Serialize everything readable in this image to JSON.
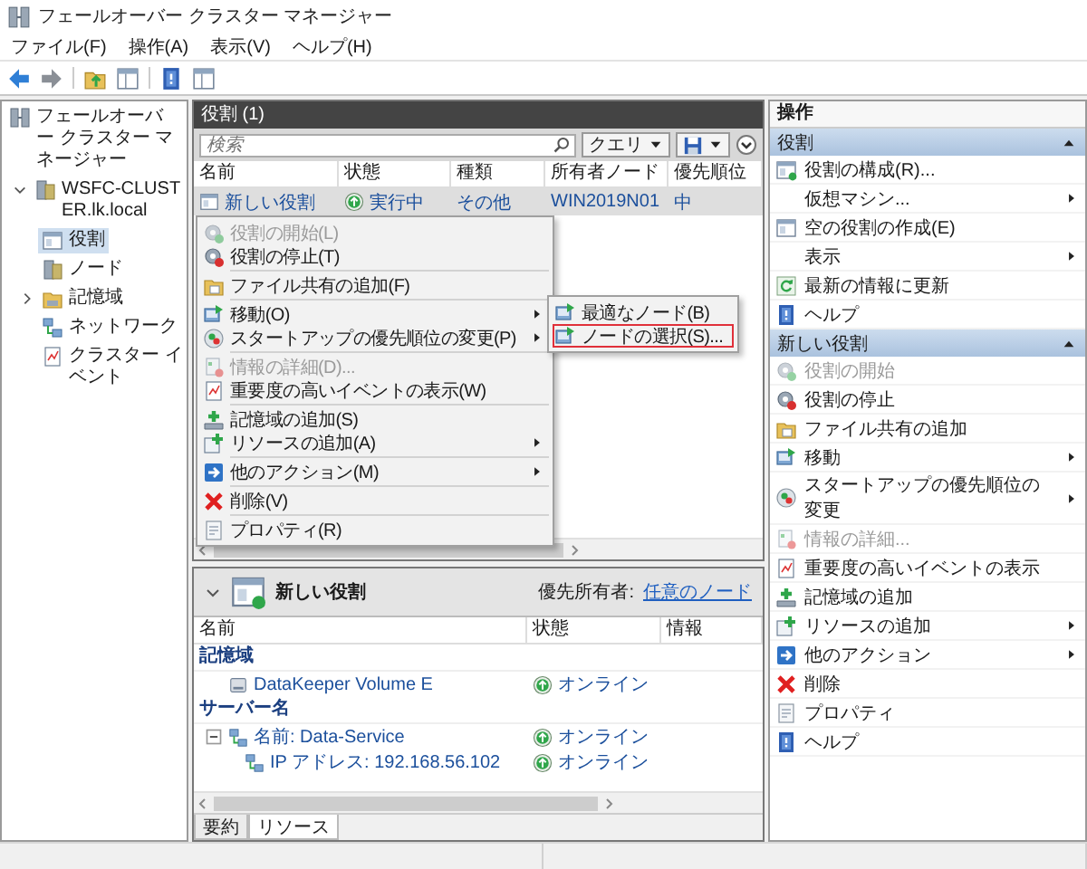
{
  "window": {
    "title": "フェールオーバー クラスター マネージャー"
  },
  "menu_bar": [
    "ファイル(F)",
    "操作(A)",
    "表示(V)",
    "ヘルプ(H)"
  ],
  "tree": {
    "label": "フェールオーバー クラスター マネージャー",
    "selected": false,
    "children": [
      {
        "label": "WSFC-CLUSTER.lk.local",
        "selected": false,
        "expanded": true,
        "children": [
          {
            "label": "役割",
            "selected": true
          },
          {
            "label": "ノード",
            "selected": false
          },
          {
            "label": "記憶域",
            "selected": false,
            "expanded": false
          },
          {
            "label": "ネットワーク",
            "selected": false
          },
          {
            "label": "クラスター イベント",
            "selected": false
          }
        ]
      }
    ]
  },
  "roles_pane": {
    "title": "役割 (1)",
    "search": {
      "placeholder": "検索"
    },
    "query_button": "クエリ",
    "columns": [
      "名前",
      "状態",
      "種類",
      "所有者ノード",
      "優先順位"
    ],
    "rows": [
      {
        "name": "新しい役割",
        "status": "実行中",
        "type": "その他",
        "owner_node": "WIN2019N01",
        "priority": "中",
        "selected": true
      }
    ]
  },
  "context_menu": {
    "groups": [
      [
        {
          "label": "役割の開始(L)",
          "disabled": true,
          "has_submenu": false
        },
        {
          "label": "役割の停止(T)",
          "disabled": false,
          "has_submenu": false
        }
      ],
      [
        {
          "label": "ファイル共有の追加(F)",
          "disabled": false,
          "has_submenu": false
        }
      ],
      [
        {
          "label": "移動(O)",
          "disabled": false,
          "has_submenu": true,
          "submenu": [
            {
              "label": "最適なノード(B)",
              "marked": false
            },
            {
              "label": "ノードの選択(S)...",
              "marked": true
            }
          ]
        },
        {
          "label": "スタートアップの優先順位の変更(P)",
          "disabled": false,
          "has_submenu": true
        }
      ],
      [
        {
          "label": "情報の詳細(D)...",
          "disabled": true,
          "has_submenu": false
        },
        {
          "label": "重要度の高いイベントの表示(W)",
          "disabled": false,
          "has_submenu": false
        }
      ],
      [
        {
          "label": "記憶域の追加(S)",
          "disabled": false,
          "has_submenu": false
        },
        {
          "label": "リソースの追加(A)",
          "disabled": false,
          "has_submenu": true
        }
      ],
      [
        {
          "label": "他のアクション(M)",
          "disabled": false,
          "has_submenu": true
        }
      ],
      [
        {
          "label": "削除(V)",
          "disabled": false,
          "has_submenu": false
        }
      ],
      [
        {
          "label": "プロパティ(R)",
          "disabled": false,
          "has_submenu": false
        }
      ]
    ]
  },
  "details_pane": {
    "title": "新しい役割",
    "preferred_owner_label": "優先所有者:",
    "preferred_owner_link": "任意のノード",
    "columns": [
      "名前",
      "状態",
      "情報"
    ],
    "groups": [
      {
        "name": "記憶域",
        "items": [
          {
            "name": "DataKeeper Volume E",
            "status": "オンライン"
          }
        ]
      },
      {
        "name": "サーバー名",
        "items": [
          {
            "name": "名前: Data-Service",
            "status": "オンライン",
            "expanded": true,
            "children": [
              {
                "name": "IP アドレス: 192.168.56.102",
                "status": "オンライン"
              }
            ]
          }
        ]
      }
    ],
    "tabs": [
      {
        "label": "要約",
        "selected": false
      },
      {
        "label": "リソース",
        "selected": true
      }
    ]
  },
  "actions_pane": {
    "title": "操作",
    "sections": [
      {
        "title": "役割",
        "expanded": true,
        "items": [
          {
            "label": "役割の構成(R)...",
            "disabled": false,
            "has_submenu": false
          },
          {
            "label": "仮想マシン...",
            "disabled": false,
            "has_submenu": true
          },
          {
            "label": "空の役割の作成(E)",
            "disabled": false,
            "has_submenu": false
          },
          {
            "label": "表示",
            "disabled": false,
            "has_submenu": true
          },
          {
            "label": "最新の情報に更新",
            "disabled": false,
            "has_submenu": false
          },
          {
            "label": "ヘルプ",
            "disabled": false,
            "has_submenu": false
          }
        ]
      },
      {
        "title": "新しい役割",
        "expanded": true,
        "items": [
          {
            "label": "役割の開始",
            "disabled": true,
            "has_submenu": false
          },
          {
            "label": "役割の停止",
            "disabled": false,
            "has_submenu": false
          },
          {
            "label": "ファイル共有の追加",
            "disabled": false,
            "has_submenu": false
          },
          {
            "label": "移動",
            "disabled": false,
            "has_submenu": true
          },
          {
            "label": "スタートアップの優先順位の変更",
            "disabled": false,
            "has_submenu": true
          },
          {
            "label": "情報の詳細...",
            "disabled": true,
            "has_submenu": false
          },
          {
            "label": "重要度の高いイベントの表示",
            "disabled": false,
            "has_submenu": false
          },
          {
            "label": "記憶域の追加",
            "disabled": false,
            "has_submenu": false
          },
          {
            "label": "リソースの追加",
            "disabled": false,
            "has_submenu": true
          },
          {
            "label": "他のアクション",
            "disabled": false,
            "has_submenu": true
          },
          {
            "label": "削除",
            "disabled": false,
            "has_submenu": false
          },
          {
            "label": "プロパティ",
            "disabled": false,
            "has_submenu": false
          },
          {
            "label": "ヘルプ",
            "disabled": false,
            "has_submenu": false
          }
        ]
      }
    ]
  }
}
